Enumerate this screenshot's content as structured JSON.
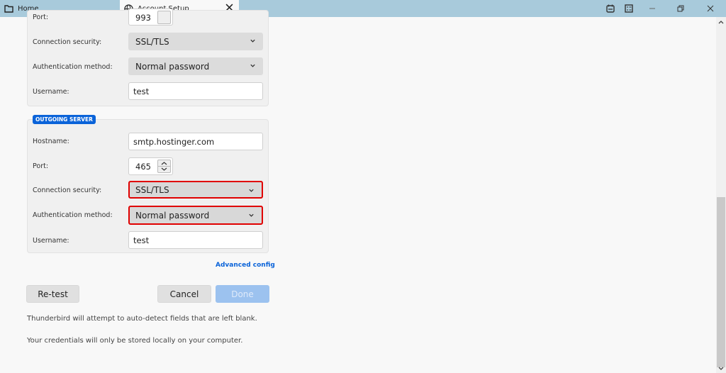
{
  "tabs": {
    "home": "Home",
    "active": "Account Setup"
  },
  "incoming": {
    "port_label": "Port:",
    "port": "993",
    "security_label": "Connection security:",
    "security": "SSL/TLS",
    "auth_label": "Authentication method:",
    "auth": "Normal password",
    "username_label": "Username:",
    "username": "test"
  },
  "outgoing": {
    "badge": "OUTGOING SERVER",
    "hostname_label": "Hostname:",
    "hostname": "smtp.hostinger.com",
    "port_label": "Port:",
    "port": "465",
    "security_label": "Connection security:",
    "security": "SSL/TLS",
    "auth_label": "Authentication method:",
    "auth": "Normal password",
    "username_label": "Username:",
    "username": "test"
  },
  "advanced": "Advanced config",
  "buttons": {
    "retest": "Re-test",
    "cancel": "Cancel",
    "done": "Done"
  },
  "notes": [
    "Thunderbird will attempt to auto-detect fields that are left blank.",
    "Your credentials will only be stored locally on your computer."
  ],
  "colors": {
    "accent": "#0a63d9",
    "highlight": "#e00000",
    "tabbar": "#a8cadb",
    "done": "#9cc2ef"
  },
  "scroll_position": 0.5
}
